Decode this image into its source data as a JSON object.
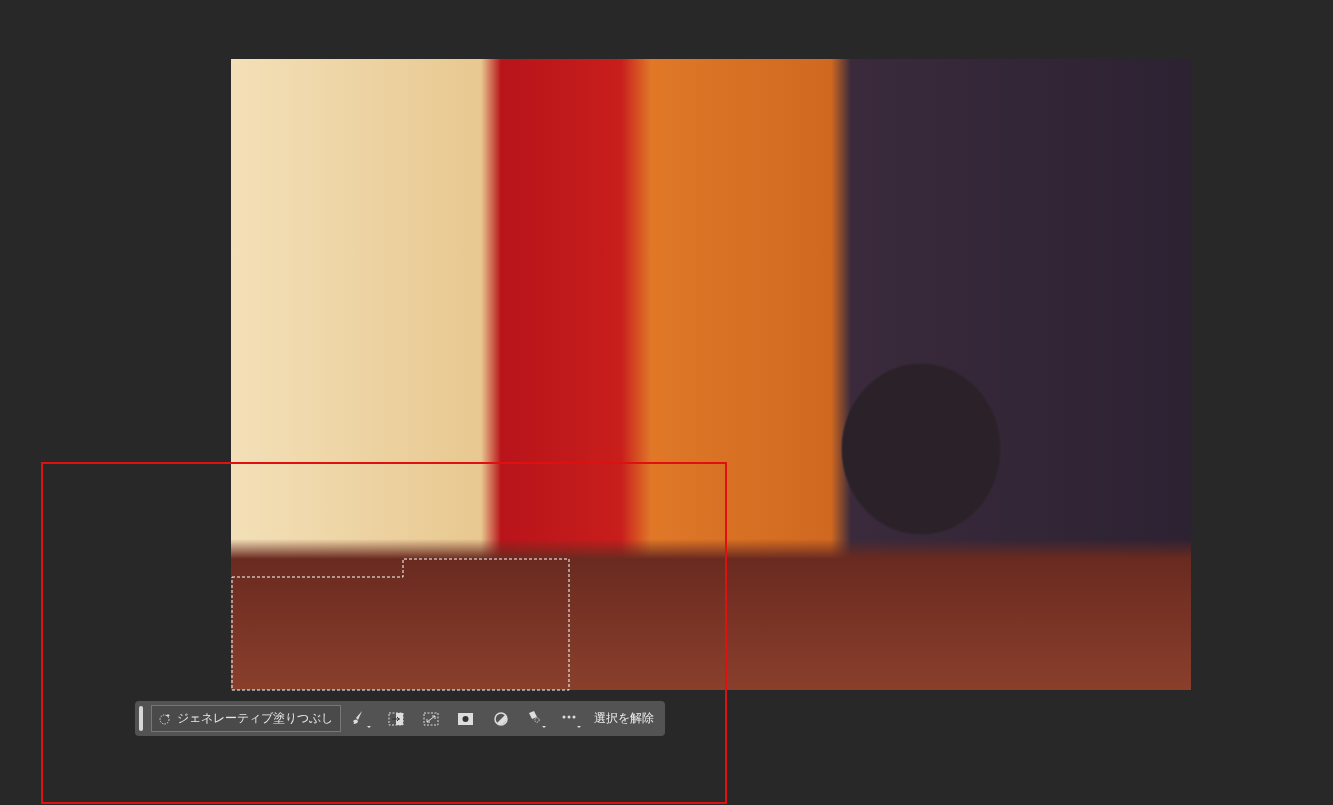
{
  "taskbar": {
    "generative_fill_button": "ジェネレーティブ塗りつぶし",
    "deselect_button": "選択を解除"
  }
}
